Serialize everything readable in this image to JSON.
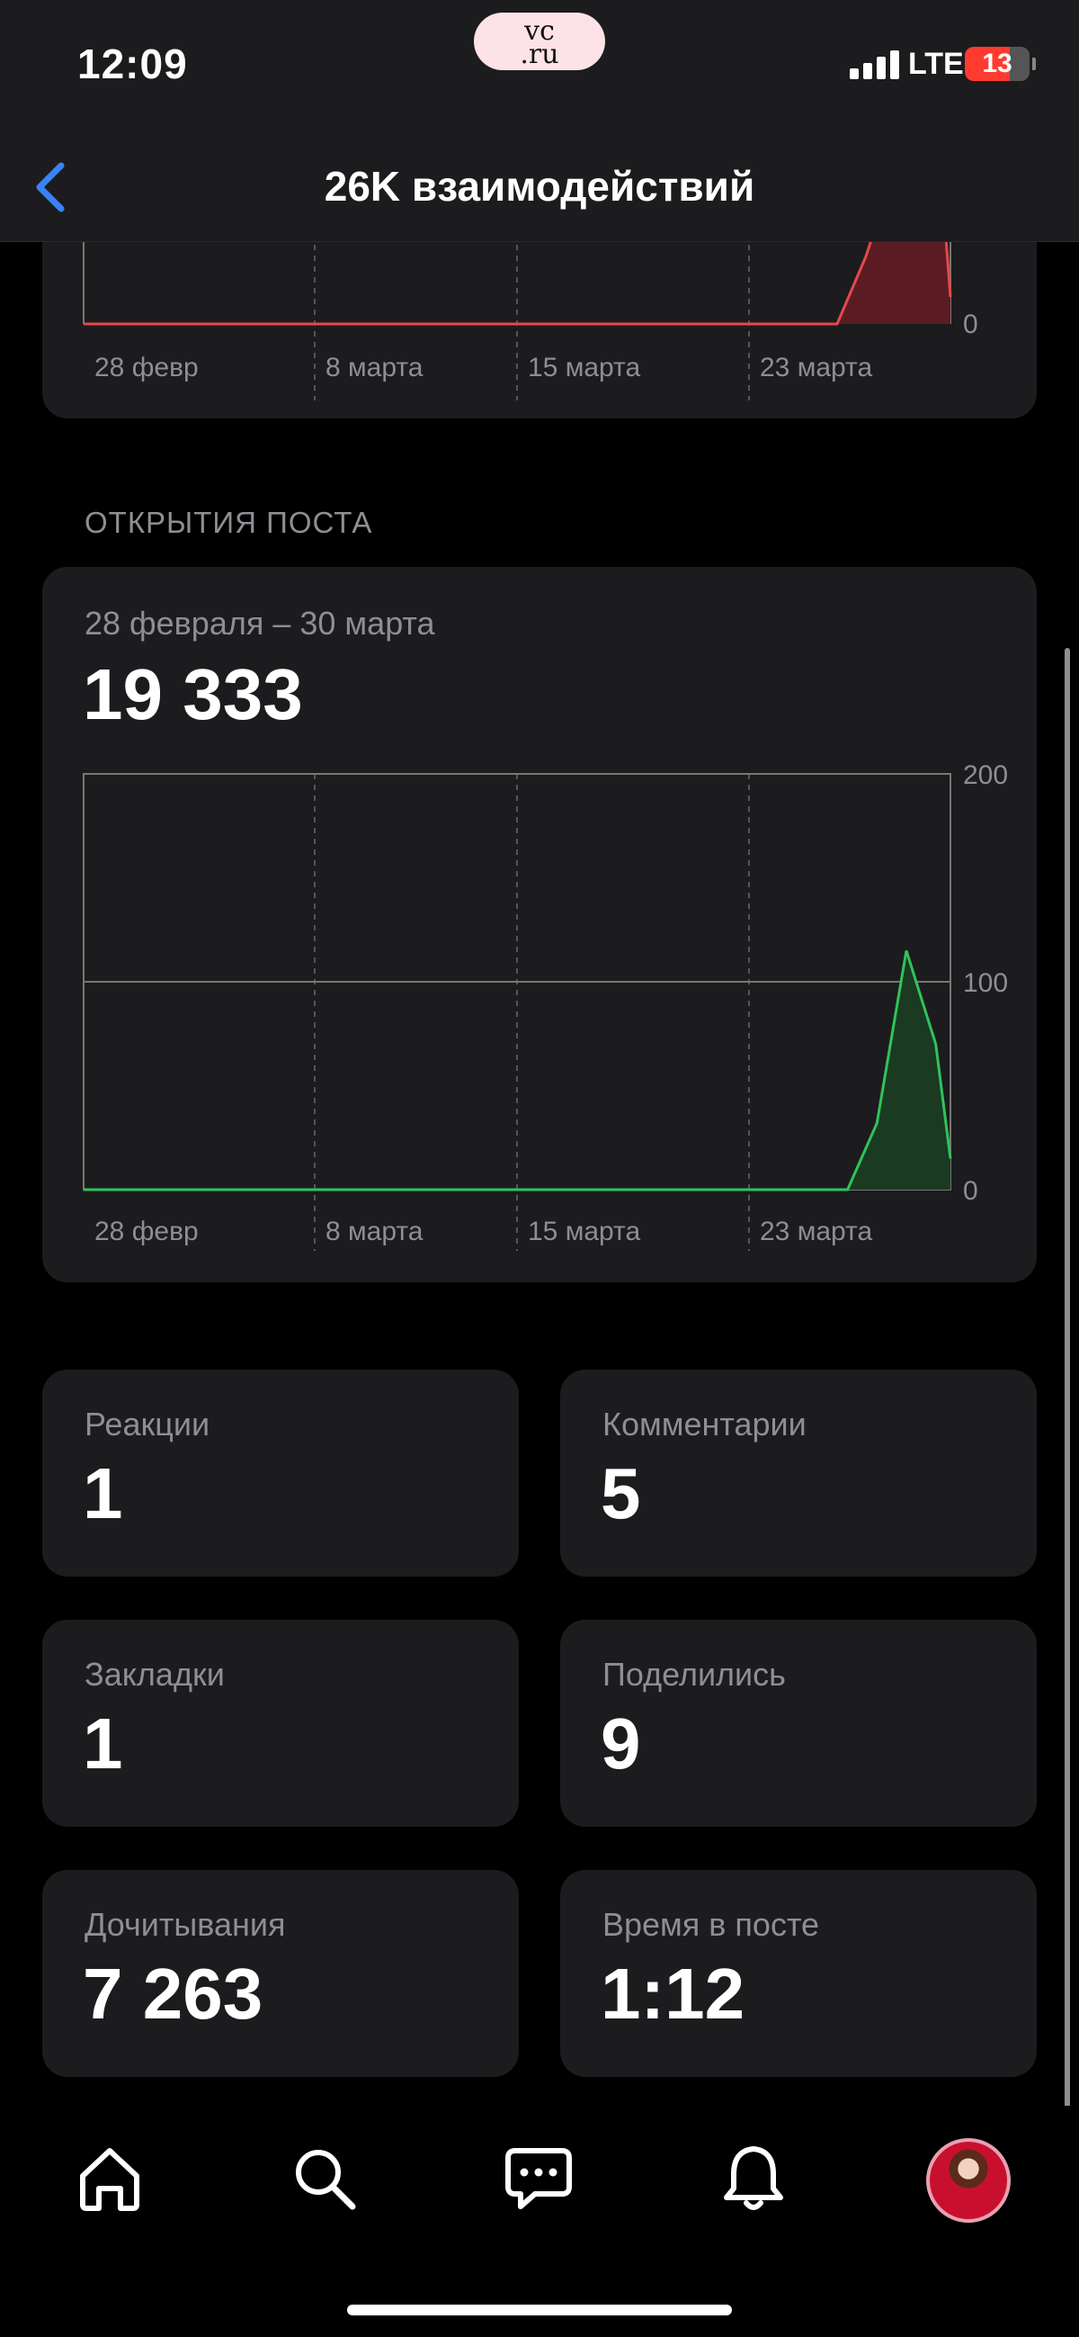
{
  "status_bar": {
    "time": "12:09",
    "app_badge": "vc\n.ru",
    "network": "LTE",
    "battery": "13"
  },
  "nav": {
    "title": "26K взаимодействий"
  },
  "interactions_chart_tail": {
    "chart_data": {
      "type": "area",
      "x_tick_labels": [
        "28 февр",
        "8 марта",
        "15 марта",
        "23 марта"
      ],
      "y_tick_labels": [
        "0"
      ],
      "color": "#e5484d"
    }
  },
  "post_opens": {
    "section_label": "ОТКРЫТИЯ ПОСТА",
    "period": "28 февраля – 30 марта",
    "total": "19 333",
    "chart_data": {
      "type": "area",
      "x_tick_labels": [
        "28 февр",
        "8 марта",
        "15 марта",
        "23 марта"
      ],
      "y_tick_labels": [
        "0",
        "100",
        "200"
      ],
      "ylim": [
        0,
        200
      ],
      "x": [
        1,
        2,
        3,
        4,
        5,
        6,
        7,
        8,
        9,
        10,
        11,
        12,
        13,
        14,
        15,
        16,
        17,
        18,
        18.5,
        19,
        20,
        21,
        22,
        23,
        24,
        25,
        26,
        27,
        28,
        29,
        30
      ],
      "values": [
        0,
        0,
        0,
        0,
        0,
        0,
        0,
        0,
        0,
        0,
        0,
        0,
        0,
        0,
        0,
        0,
        0,
        0,
        0,
        0,
        0,
        0,
        0,
        0,
        0,
        0,
        0,
        0,
        32,
        115,
        70
      ],
      "last_value": 15,
      "color": "#30c35a",
      "grid": true
    }
  },
  "stats": [
    {
      "label": "Реакции",
      "value": "1"
    },
    {
      "label": "Комментарии",
      "value": "5"
    },
    {
      "label": "Закладки",
      "value": "1"
    },
    {
      "label": "Поделились",
      "value": "9"
    },
    {
      "label": "Дочитывания",
      "value": "7 263"
    },
    {
      "label": "Время в посте",
      "value": "1:12"
    }
  ],
  "tabbar": {
    "icons": [
      "home-icon",
      "search-icon",
      "messages-icon",
      "bell-icon",
      "avatar"
    ]
  }
}
